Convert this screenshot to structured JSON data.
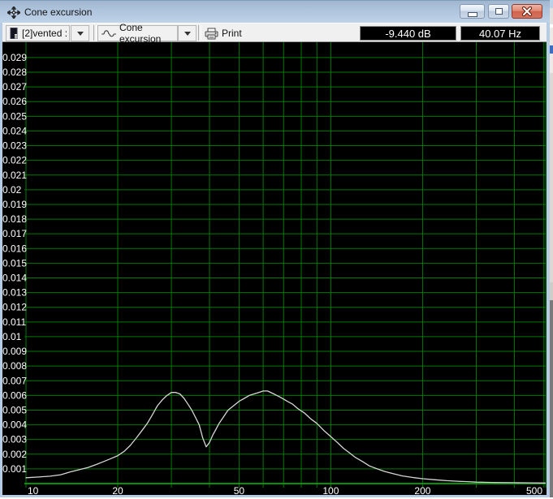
{
  "window": {
    "title": "Cone excursion"
  },
  "titlebar": {
    "app_icon": "crosshair-plot-icon",
    "buttons": [
      "minimize",
      "maximize",
      "close"
    ]
  },
  "toolbar": {
    "driver_select": {
      "value": "[2]vented :",
      "icon": "driver-box-icon"
    },
    "graph_select": {
      "value": "Cone excursion",
      "icon": "waveform-icon"
    },
    "print_label": "Print",
    "print_icon": "printer-icon",
    "readout_db": "-9.440 dB",
    "readout_hz": "40.07 Hz"
  },
  "chart_data": {
    "type": "line",
    "title": "Cone excursion",
    "xlabel": "",
    "ylabel": "",
    "x_scale": "log",
    "xlim": [
      10,
      507
    ],
    "ylim": [
      0,
      0.0299
    ],
    "grid": true,
    "background": "#000000",
    "grid_color": "#007a00",
    "axis_color": "#009400",
    "curve_color": "#d6d6d6",
    "label_color": "#ffffff",
    "x_ticks": [
      10,
      20,
      50,
      100,
      200,
      500
    ],
    "x_tick_labels": [
      "10",
      "20",
      "50",
      "100",
      "200",
      "500"
    ],
    "x_gridlines": [
      10,
      20,
      30,
      40,
      50,
      60,
      70,
      80,
      90,
      100,
      200,
      300,
      400,
      500
    ],
    "y_gridline_step": 0.001,
    "y_tick_labels": [
      "0.029",
      "0.028",
      "0.027",
      "0.026",
      "0.025",
      "0.024",
      "0.023",
      "0.022",
      "0.021",
      "0.02",
      "0.019",
      "0.018",
      "0.017",
      "0.016",
      "0.015",
      "0.014",
      "0.013",
      "0.012",
      "0.011",
      "0.01",
      "0.009",
      "0.008",
      "0.007",
      "0.006",
      "0.005",
      "0.004",
      "0.003",
      "0.002",
      "0.001"
    ],
    "series": [
      {
        "name": "Cone excursion",
        "points": [
          [
            10,
            0.0004
          ],
          [
            11,
            0.00045
          ],
          [
            12,
            0.0005
          ],
          [
            13,
            0.0006
          ],
          [
            14,
            0.0008
          ],
          [
            15,
            0.00095
          ],
          [
            16,
            0.0011
          ],
          [
            17,
            0.0013
          ],
          [
            18,
            0.0015
          ],
          [
            19,
            0.0017
          ],
          [
            20,
            0.0019
          ],
          [
            21,
            0.0022
          ],
          [
            22,
            0.0026
          ],
          [
            23,
            0.0031
          ],
          [
            24,
            0.0036
          ],
          [
            25,
            0.0041
          ],
          [
            26,
            0.0047
          ],
          [
            27,
            0.0053
          ],
          [
            28,
            0.0057
          ],
          [
            29,
            0.006
          ],
          [
            30,
            0.0062
          ],
          [
            31,
            0.0062
          ],
          [
            32,
            0.0061
          ],
          [
            33,
            0.0058
          ],
          [
            34,
            0.0054
          ],
          [
            35,
            0.005
          ],
          [
            36,
            0.0045
          ],
          [
            37,
            0.004
          ],
          [
            38,
            0.0031
          ],
          [
            39,
            0.0025
          ],
          [
            40,
            0.0028
          ],
          [
            41,
            0.0033
          ],
          [
            42,
            0.0037
          ],
          [
            43,
            0.0041
          ],
          [
            44,
            0.0044
          ],
          [
            45,
            0.0047
          ],
          [
            46,
            0.005
          ],
          [
            48,
            0.0053
          ],
          [
            50,
            0.0056
          ],
          [
            52,
            0.0058
          ],
          [
            54,
            0.006
          ],
          [
            56,
            0.0061
          ],
          [
            58,
            0.0062
          ],
          [
            60,
            0.0063
          ],
          [
            62,
            0.0063
          ],
          [
            65,
            0.0061
          ],
          [
            68,
            0.0059
          ],
          [
            72,
            0.0056
          ],
          [
            75,
            0.0054
          ],
          [
            78,
            0.0051
          ],
          [
            82,
            0.0048
          ],
          [
            86,
            0.0044
          ],
          [
            90,
            0.0041
          ],
          [
            95,
            0.0036
          ],
          [
            100,
            0.0032
          ],
          [
            105,
            0.0028
          ],
          [
            110,
            0.0024
          ],
          [
            115,
            0.0021
          ],
          [
            120,
            0.0018
          ],
          [
            127,
            0.0015
          ],
          [
            134,
            0.0012
          ],
          [
            142,
            0.001
          ],
          [
            150,
            0.00083
          ],
          [
            160,
            0.00068
          ],
          [
            172,
            0.00052
          ],
          [
            185,
            0.00042
          ],
          [
            200,
            0.00033
          ],
          [
            220,
            0.00026
          ],
          [
            240,
            0.0002
          ],
          [
            260,
            0.00016
          ],
          [
            280,
            0.00013
          ],
          [
            300,
            0.0001
          ],
          [
            340,
            8e-05
          ],
          [
            400,
            6e-05
          ],
          [
            450,
            5e-05
          ],
          [
            505,
            4e-05
          ]
        ]
      }
    ]
  }
}
